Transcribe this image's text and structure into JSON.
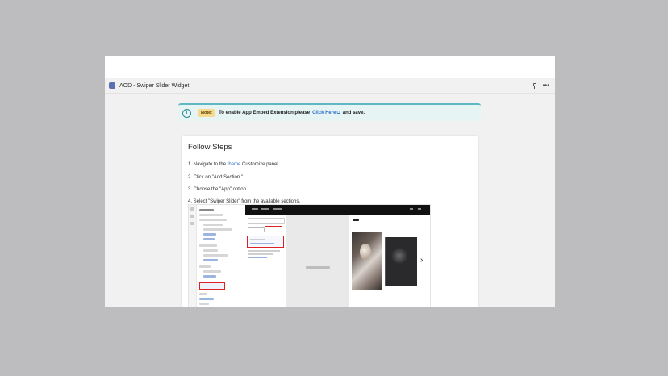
{
  "window": {
    "title": "AOD - Swiper Slider Widget",
    "pin_icon": "pin-icon",
    "more_icon": "more-horizontal-icon"
  },
  "banner": {
    "icon": "info-icon",
    "note_label": "Note:",
    "text": "To enable App Embed Extension please",
    "link_text": "Click Here",
    "link_icon": "external-link-icon",
    "trailing_text": "and save."
  },
  "card": {
    "title": "Follow Steps",
    "steps": [
      {
        "prefix": "1. Navigate to the ",
        "highlight": "theme",
        "suffix": " Customize panel."
      },
      {
        "text": "2. Click on \"Add Section.\""
      },
      {
        "text": "3. Choose the \"App\" option."
      },
      {
        "text": "4. Select \"Swiper Slider\" from the available sections."
      }
    ]
  },
  "chat": {
    "icon": "chat-bubble-icon"
  }
}
